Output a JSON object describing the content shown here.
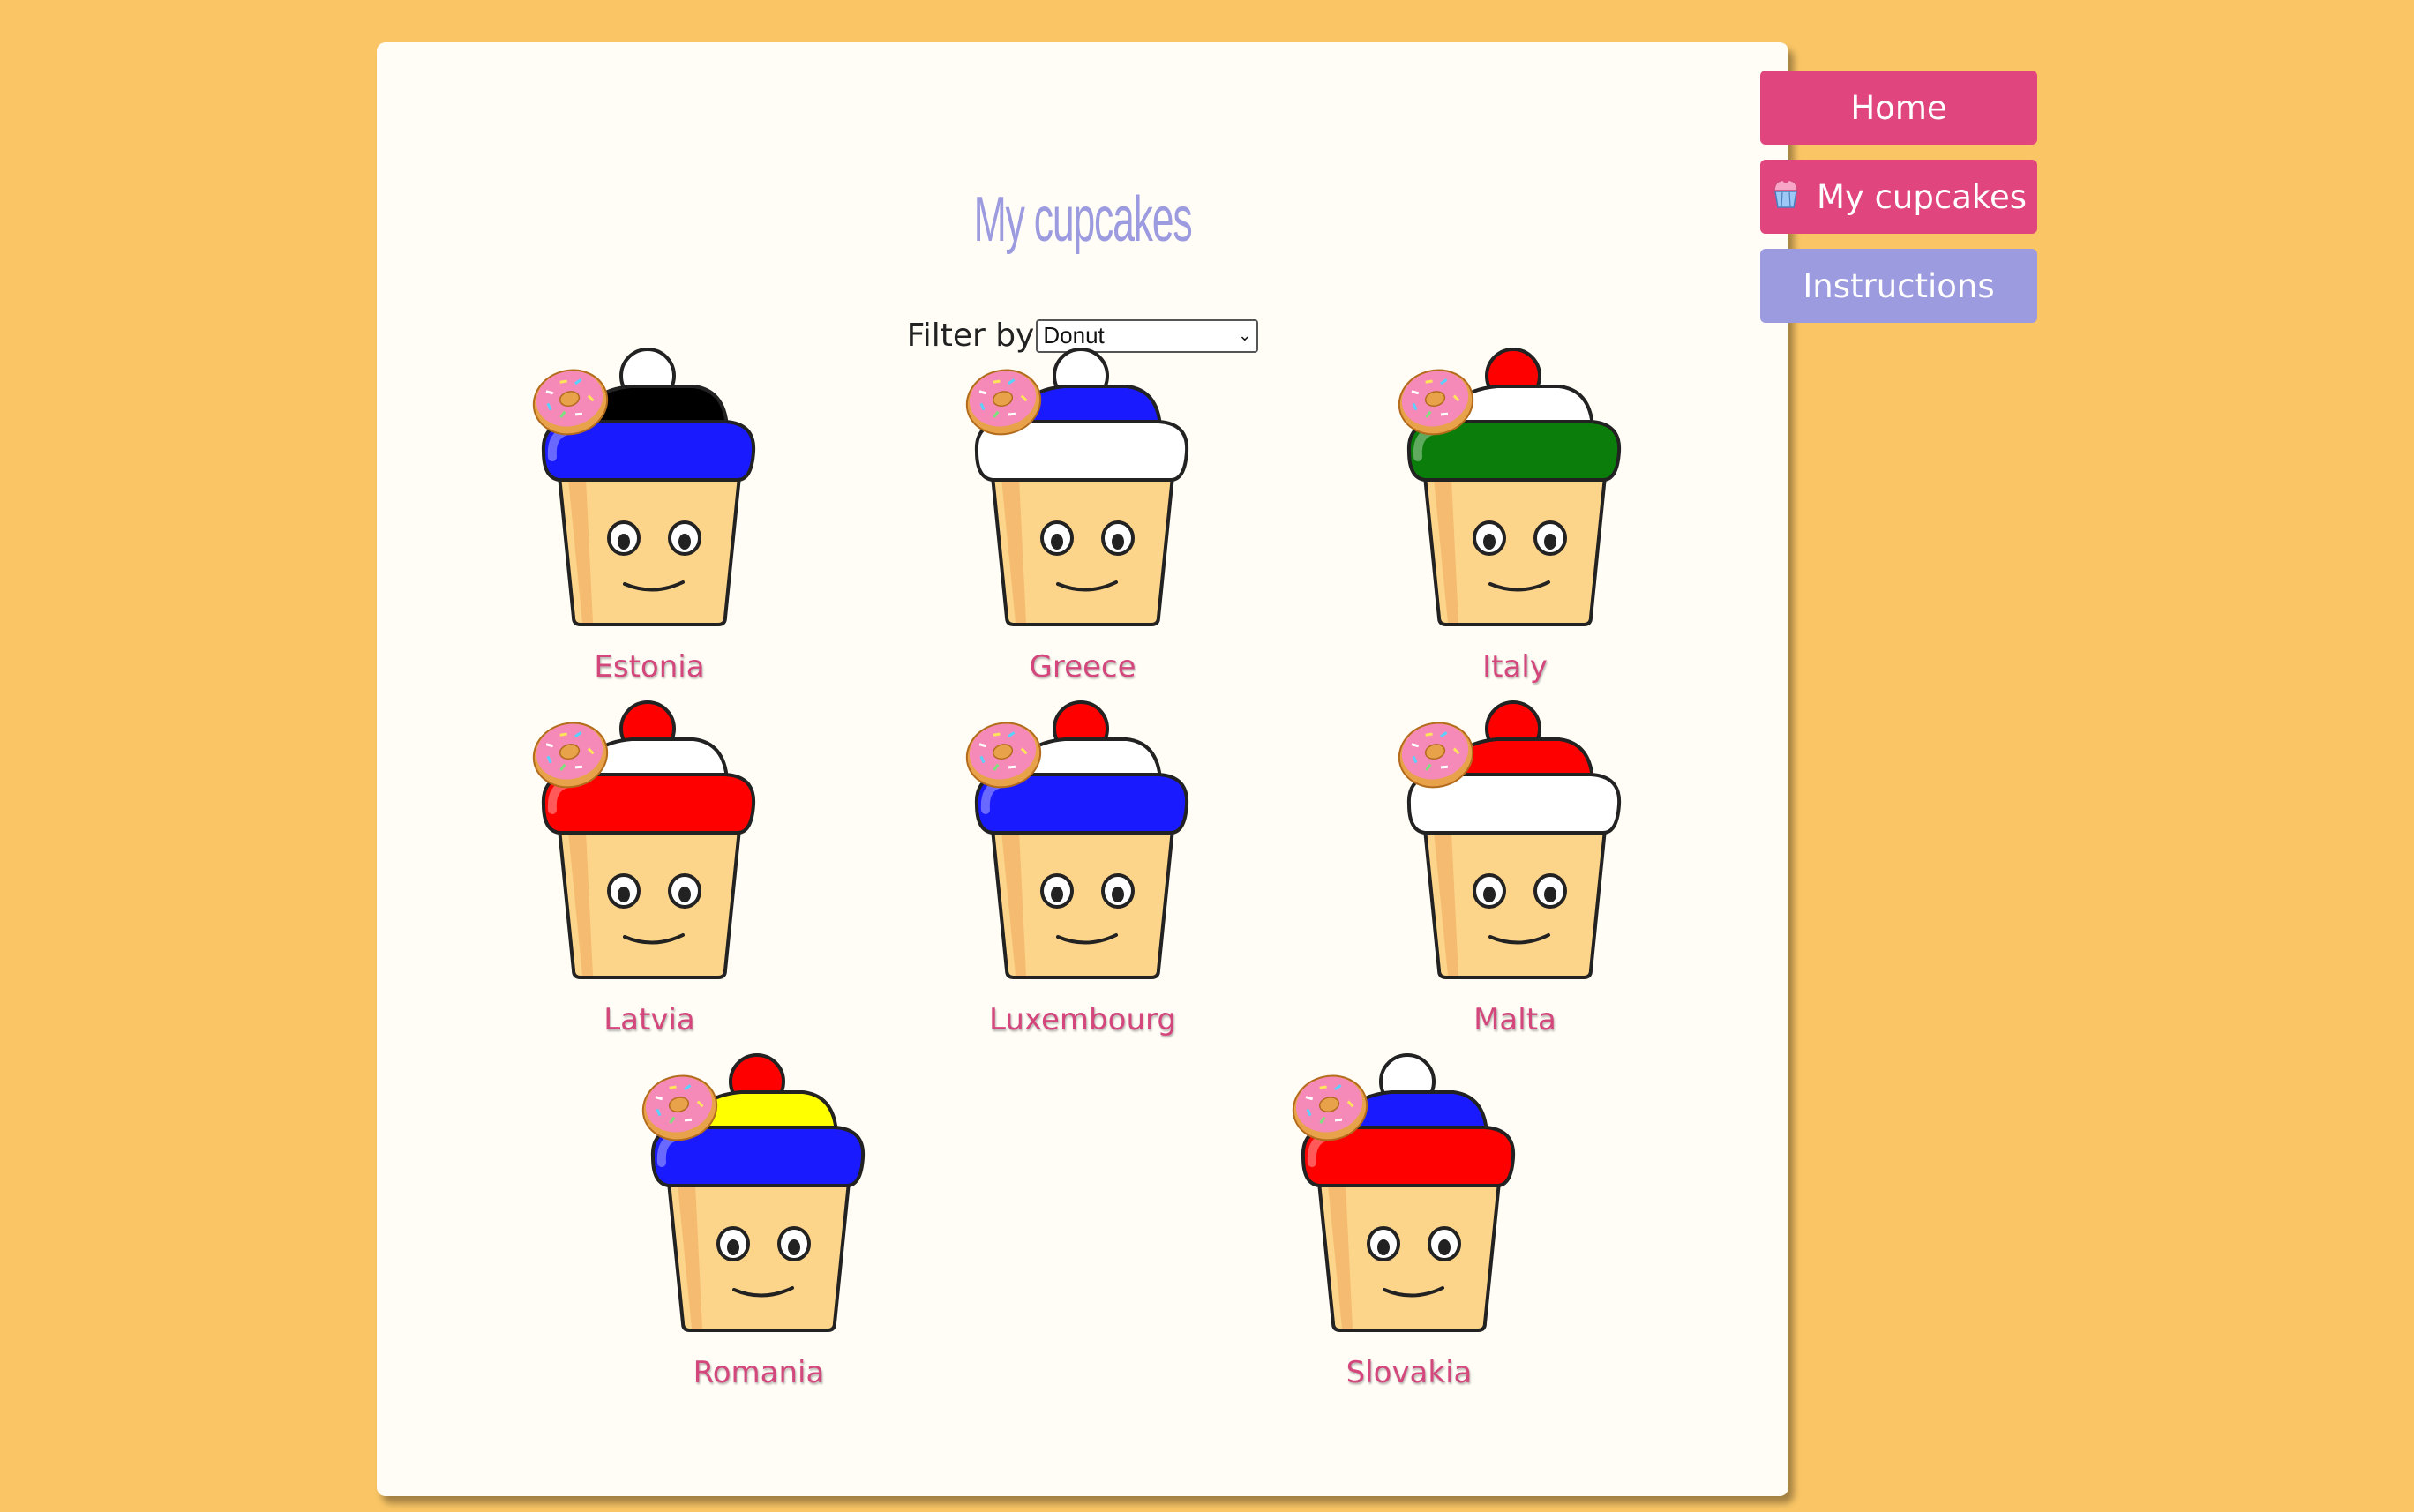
{
  "page": {
    "title": "My cupcakes",
    "filter_label": "Filter by",
    "filter_selected": "Donut"
  },
  "nav": {
    "home": "Home",
    "my_cupcakes": "My cupcakes",
    "instructions": "Instructions"
  },
  "topping_icon": "donut-icon",
  "cupcakes": [
    {
      "name": "Estonia",
      "frosting": [
        "#1a1aff",
        "#000000"
      ],
      "top": "#ffffff"
    },
    {
      "name": "Greece",
      "frosting": [
        "#ffffff",
        "#1a1aff"
      ],
      "top": "#ffffff"
    },
    {
      "name": "Italy",
      "frosting": [
        "#0a7d0a",
        "#ffffff"
      ],
      "top": "#ff0000"
    },
    {
      "name": "Latvia",
      "frosting": [
        "#ff0000",
        "#ffffff"
      ],
      "top": "#ff0000"
    },
    {
      "name": "Luxembourg",
      "frosting": [
        "#1a1aff",
        "#ffffff"
      ],
      "top": "#ff0000"
    },
    {
      "name": "Malta",
      "frosting": [
        "#ffffff",
        "#ff0000"
      ],
      "top": "#ff0000"
    },
    {
      "name": "Romania",
      "frosting": [
        "#1a1aff",
        "#ffff00"
      ],
      "top": "#ff0000"
    },
    {
      "name": "Slovakia",
      "frosting": [
        "#ff0000",
        "#1a1aff"
      ],
      "top": "#ffffff"
    }
  ]
}
